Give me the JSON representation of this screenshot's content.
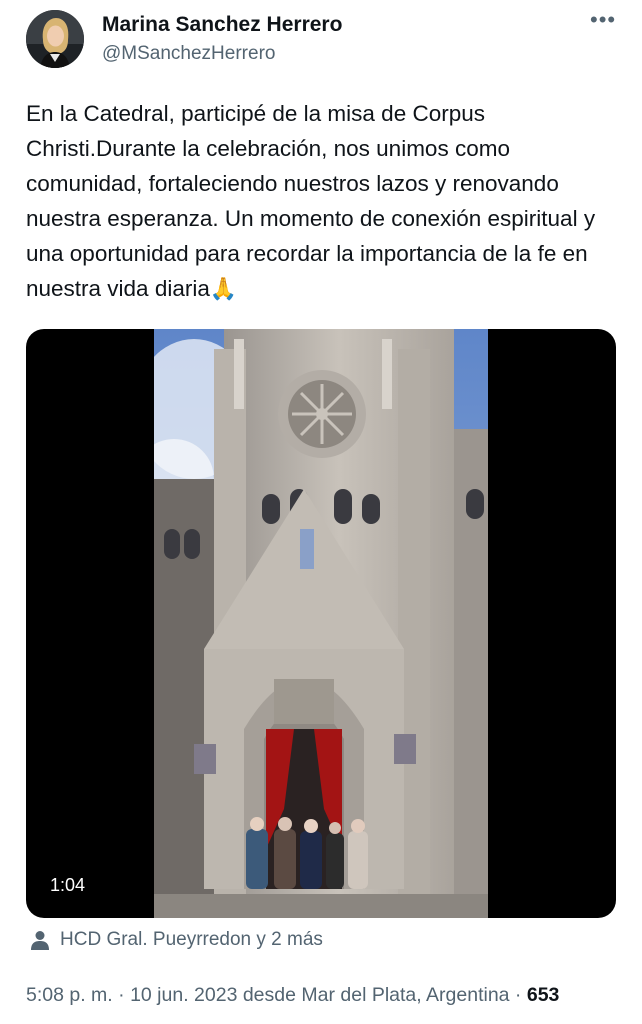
{
  "author": {
    "name": "Marina Sanchez Herrero",
    "handle": "@MSanchezHerrero"
  },
  "more_icon": "more-dots-icon",
  "tweet": {
    "text": "En la Catedral, participé de la misa de Corpus Christi.Durante la celebración, nos unimos como comunidad, fortaleciendo nuestros lazos y renovando nuestra esperanza. Un momento de conexión espiritual y una oportunidad para recordar la importancia de la fe en nuestra vida diaria",
    "emoji": "🙏"
  },
  "media": {
    "type": "video",
    "duration": "1:04"
  },
  "tags": {
    "icon": "person-icon",
    "label": "HCD Gral. Pueyrredon y 2 más"
  },
  "meta": {
    "time": "5:08 p. m.",
    "separator1": " · ",
    "date": "10 jun. 2023",
    "location": " desde Mar del Plata, Argentina",
    "separator2": " · ",
    "views": "653"
  },
  "colors": {
    "text": "#0f1419",
    "secondary": "#536471",
    "media_bg": "#000000"
  }
}
